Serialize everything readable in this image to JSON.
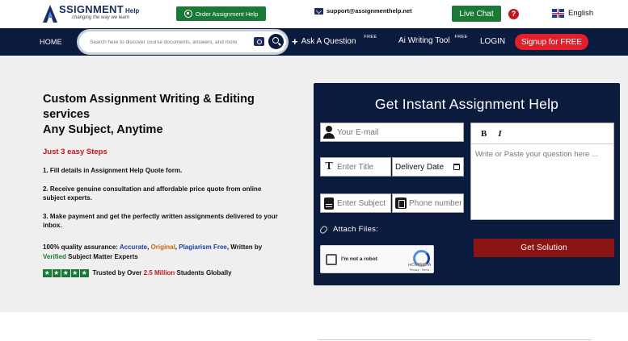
{
  "header": {
    "logo_word": "SSIGNMENT",
    "logo_help": "Help",
    "logo_tagline": "changing the way we learn",
    "whatsapp_label": "Order Assignment Help",
    "email": "support@assignmenthelp.net",
    "livechat_label": "Live Chat",
    "help_symbol": "?",
    "language": "English"
  },
  "nav": {
    "home": "HOME",
    "search_placeholder": "Search here to discover course documents, answers, and more",
    "ask_label": "Ask A Question",
    "ask_badge": "FREE",
    "ai_label": "Ai Writing Tool",
    "ai_badge": "FREE",
    "login": "LOGIN",
    "signup": "Signup for FREE"
  },
  "hero": {
    "title_line1": "Custom Assignment Writing & Editing services",
    "title_line2": "Any Subject, Anytime",
    "steps_title": "Just 3 easy Steps",
    "step1": "1. Fill details in Assignment Help Quote form.",
    "step2": "2. Receive genuine consultation and affordable price quote from online subject experts.",
    "step3": "3. Make payment and get the perfectly written assignments delivered to your inbox.",
    "quality_prefix": "100% quality assurance: ",
    "quality_accurate": "Accurate",
    "quality_sep1": ", ",
    "quality_original": "Original",
    "quality_sep2": ", ",
    "quality_plagiarism": "Plagiarism Free",
    "quality_mid": ", Written by ",
    "quality_verified": "Verified",
    "quality_suffix": " Subject Matter Experts",
    "rating_stars": 5,
    "trust_prefix": "Trusted by Over ",
    "trust_count": "2.5 Million",
    "trust_suffix": " Students Globally"
  },
  "form": {
    "title": "Get Instant Assignment Help",
    "email_placeholder": "Your E-mail",
    "title_placeholder": "Enter Title",
    "delivery_label": "Delivery Date",
    "subject_placeholder": "Enter Subject",
    "phone_placeholder": "Phone number",
    "editor_bold": "B",
    "editor_italic": "I",
    "editor_placeholder": "Write or Paste your question here ...",
    "attach_label": "Attach Files:",
    "captcha_label": "I'm not a robot",
    "captcha_brand": "reCAPTCHA",
    "captcha_terms": "Privacy - Terms",
    "submit_label": "Get Solution"
  },
  "colors": {
    "navy": "#0a1b3d",
    "green": "#1a7a35",
    "red": "#e11e2a",
    "dark_red": "#8b1414"
  }
}
